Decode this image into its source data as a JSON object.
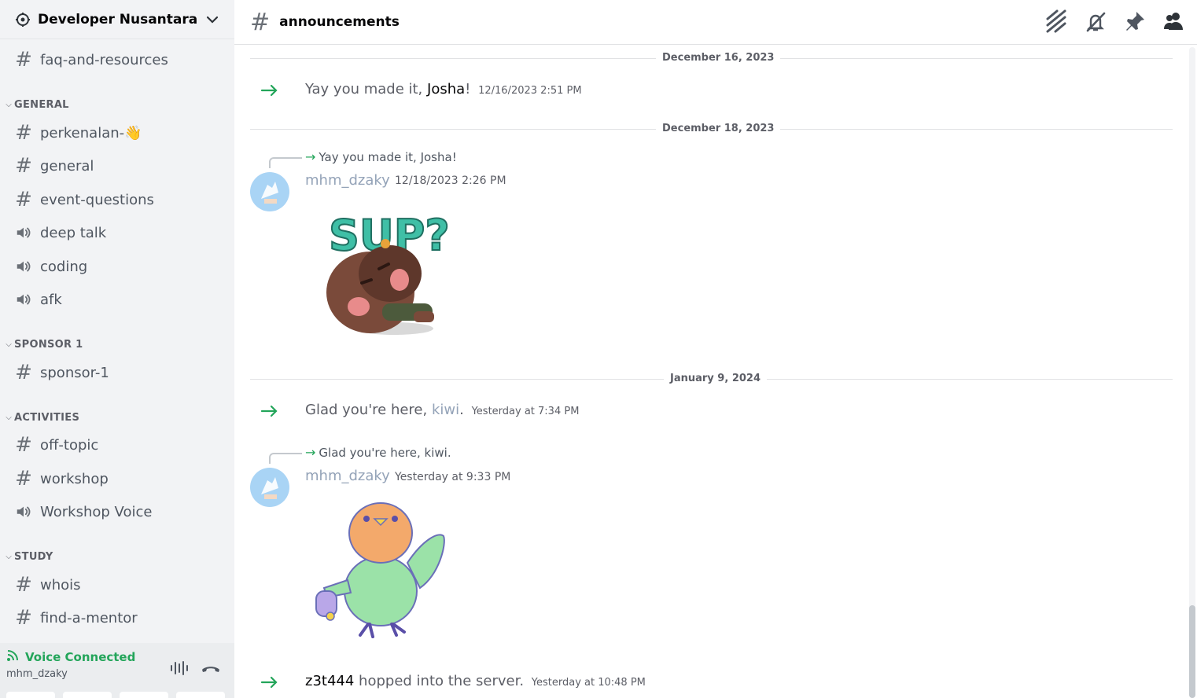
{
  "server": {
    "name": "Developer Nusantara"
  },
  "channels": {
    "faq": "faq-and-resources",
    "cat_general": "GENERAL",
    "perkenalan": "perkenalan-",
    "perkenalan_emoji": "👋",
    "general": "general",
    "event_questions": "event-questions",
    "deep_talk": "deep talk",
    "coding": "coding",
    "afk": "afk",
    "cat_sponsor": "SPONSOR 1",
    "sponsor1": "sponsor-1",
    "cat_activities": "ACTIVITIES",
    "off_topic": "off-topic",
    "workshop": "workshop",
    "workshop_voice": "Workshop Voice",
    "cat_study": "STUDY",
    "whois": "whois",
    "find_mentor": "find-a-mentor"
  },
  "voice": {
    "status": "Voice Connected",
    "user": "mhm_dzaky"
  },
  "topbar": {
    "channel": "announcements",
    "icons": [
      "threads-icon",
      "mute-icon",
      "pin-icon",
      "members-icon"
    ]
  },
  "messages": {
    "div1": "December 16, 2023",
    "sys1": {
      "pre": "Yay you made it, ",
      "name": "Josha",
      "post": "!",
      "ts": "12/16/2023 2:51 PM"
    },
    "div2": "December 18, 2023",
    "reply1": "Yay you made it, Josha!",
    "msg1": {
      "author": "mhm_dzaky",
      "ts": "12/18/2023 2:26 PM",
      "sticker_text": "SUP?"
    },
    "div3": "January 9, 2024",
    "sys2": {
      "pre": "Glad you're here, ",
      "name": "kiwi",
      "post": ".",
      "ts": "Yesterday at 7:34 PM"
    },
    "reply2": "Glad you're here, kiwi.",
    "msg2": {
      "author": "mhm_dzaky",
      "ts": "Yesterday at 9:33 PM"
    },
    "sys3": {
      "name": "z3t444",
      "post": " hopped into the server.",
      "ts": "Yesterday at 10:48 PM"
    }
  },
  "colors": {
    "accent_green": "#23a55a",
    "sidebar_bg": "#f2f3f5",
    "muted_name": "#94a3b8"
  }
}
